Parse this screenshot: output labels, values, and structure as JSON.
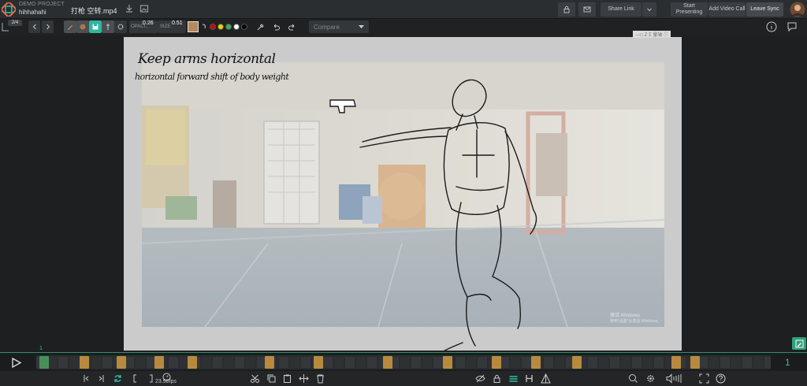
{
  "app": {
    "project_label": "DEMO PROJECT",
    "project_name": "hihhahahi",
    "file_name": "打枪 空转.mp4"
  },
  "header": {
    "share_link": "Share Link",
    "start_presenting": "Start Presenting",
    "add_video_call": "Add Video Call",
    "leave_sync": "Leave Sync"
  },
  "toolbar": {
    "frame_counter": "2/4",
    "opacity_label": "OPACI...",
    "opacity_value": "0.26",
    "size_label": "SIZE",
    "size_value": "0.51",
    "compare_label": "Compare",
    "swatches": [
      "#d40000",
      "#f2d200",
      "#3bb24a",
      "#ffffff",
      "#000000"
    ],
    "brush_color": "#b7875e"
  },
  "canvas": {
    "annotation_line1": "Keep arms horizontal",
    "annotation_line2": "horizontal forward shift of body weight",
    "watermark_line1": "激活 Windows",
    "watermark_line2": "转到\"设置\"以激活 Windows。",
    "corner_tag": "—□ Z Σ 量轴 ⓘ"
  },
  "timeline": {
    "marker_label": "1",
    "current_frame": "1",
    "fps": "23.98fps",
    "keyframe_color": "#b78a3f",
    "accent": "#2f8f6a"
  },
  "icons": [
    "menu-icon",
    "prev-icon",
    "next-icon",
    "hand-icon",
    "save-icon",
    "eyedropper-icon",
    "undo-icon",
    "redo-icon",
    "info-icon",
    "comment-icon",
    "play-icon",
    "loop-icon",
    "scissors-icon",
    "copy-icon",
    "paste-icon",
    "trash-icon",
    "eye-off-icon",
    "lock-icon",
    "settings-icon",
    "volume-icon",
    "help-icon",
    "fullscreen-icon"
  ]
}
